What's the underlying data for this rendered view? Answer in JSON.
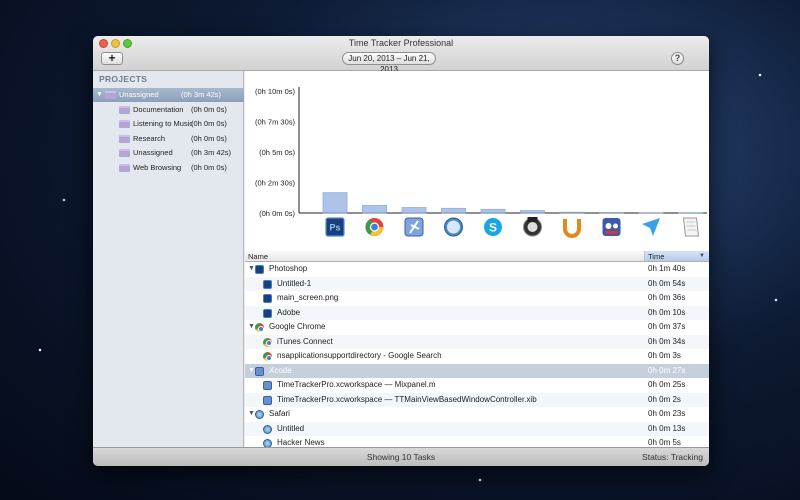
{
  "window": {
    "title": "Time Tracker Professional",
    "add_label": "+",
    "date_range": "Jun 20, 2013 – Jun 21, 2013",
    "help_label": "?"
  },
  "sidebar": {
    "header": "PROJECTS",
    "items": [
      {
        "name": "Unassigned",
        "time": "(0h 3m 42s)",
        "selected": true,
        "level": 0
      },
      {
        "name": "Documentation",
        "time": "(0h 0m 0s)",
        "level": 1
      },
      {
        "name": "Listening to Music",
        "time": "(0h 0m 0s)",
        "level": 1
      },
      {
        "name": "Research",
        "time": "(0h 0m 0s)",
        "level": 1
      },
      {
        "name": "Unassigned",
        "time": "(0h 3m 42s)",
        "level": 1
      },
      {
        "name": "Web Browsing",
        "time": "(0h 0m 0s)",
        "level": 1
      }
    ]
  },
  "chart_data": {
    "type": "bar",
    "title": "",
    "xlabel": "",
    "ylabel": "",
    "y_ticks": [
      "(0h 10m 0s)",
      "(0h 7m 30s)",
      "(0h 5m 0s)",
      "(0h 2m 30s)",
      "(0h 0m 0s)"
    ],
    "ylim_seconds": [
      0,
      600
    ],
    "categories": [
      "Photoshop",
      "Google Chrome",
      "Xcode",
      "Safari",
      "Skype",
      "Alfred",
      "Unibox",
      "Tweetbot",
      "Send",
      "TextEdit"
    ],
    "values_seconds": [
      100,
      37,
      27,
      23,
      18,
      12,
      4,
      2,
      1,
      1
    ],
    "category_icons": [
      "photoshop-icon",
      "chrome-icon",
      "xcode-icon",
      "safari-icon",
      "skype-icon",
      "alfred-icon",
      "unibox-icon",
      "tweetbot-icon",
      "send-icon",
      "textedit-icon"
    ],
    "bar_color": "#9fb9e4",
    "grid": false
  },
  "table": {
    "col_name": "Name",
    "col_time": "Time",
    "rows": [
      {
        "app": "ps",
        "label": "Photoshop",
        "time": "0h 1m 40s",
        "level": 0,
        "expanded": true
      },
      {
        "app": "ps",
        "label": "Untitled-1",
        "time": "0h 0m 54s",
        "level": 1
      },
      {
        "app": "ps",
        "label": "main_screen.png",
        "time": "0h 0m 36s",
        "level": 1
      },
      {
        "app": "ps",
        "label": "Adobe",
        "time": "0h 0m 10s",
        "level": 1
      },
      {
        "app": "chrome",
        "label": "Google Chrome",
        "time": "0h 0m 37s",
        "level": 0,
        "expanded": true
      },
      {
        "app": "chrome",
        "label": "iTunes Connect",
        "time": "0h 0m 34s",
        "level": 1
      },
      {
        "app": "chrome",
        "label": "nsapplicationsupportdirectory - Google Search",
        "time": "0h 0m 3s",
        "level": 1
      },
      {
        "app": "xcode",
        "label": "Xcode",
        "time": "0h 0m 27s",
        "level": 0,
        "expanded": true,
        "selected": true
      },
      {
        "app": "xcode",
        "label": "TimeTrackerPro.xcworkspace — Mixpanel.m",
        "time": "0h 0m 25s",
        "level": 1
      },
      {
        "app": "xcode",
        "label": "TimeTrackerPro.xcworkspace — TTMainViewBasedWindowController.xib",
        "time": "0h 0m 2s",
        "level": 1
      },
      {
        "app": "safari",
        "label": "Safari",
        "time": "0h 0m 23s",
        "level": 0,
        "expanded": true
      },
      {
        "app": "safari",
        "label": "Untitled",
        "time": "0h 0m 13s",
        "level": 1
      },
      {
        "app": "safari",
        "label": "Hacker News",
        "time": "0h 0m 5s",
        "level": 1
      }
    ]
  },
  "status": {
    "center": "Showing 10 Tasks",
    "right": "Status: Tracking"
  }
}
